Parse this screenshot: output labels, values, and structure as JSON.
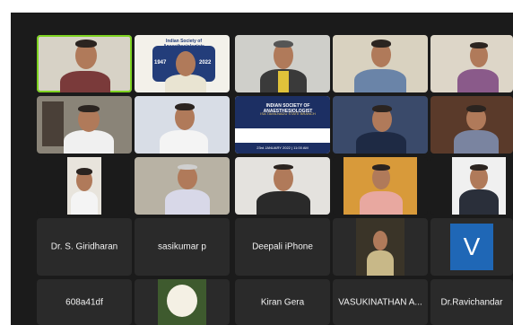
{
  "meeting": {
    "banner": {
      "title": "INDIAN SOCIETY OF ANAESTHESIOLOGIST",
      "subtitle": "ISA TAMILNADU STATE BRANCH",
      "date": "23rd JANUARY 2022 | 11:00 AM"
    },
    "logo": {
      "text": "Indian Society of Anaesthesiologists",
      "year_start": "1947",
      "year_end": "2022"
    },
    "participants_named": [
      {
        "id": "giridharan",
        "name": "Dr. S. Giridharan"
      },
      {
        "id": "sasikumar",
        "name": "sasikumar p"
      },
      {
        "id": "deepali",
        "name": "Deepali iPhone"
      },
      {
        "id": "p608a41df",
        "name": "608a41df"
      },
      {
        "id": "kiran",
        "name": "Kiran Gera"
      },
      {
        "id": "vasukinathan",
        "name": "VASUKINATHAN A..."
      },
      {
        "id": "ravichandar",
        "name": "Dr.Ravichandar"
      }
    ],
    "avatar_letter": "V"
  },
  "colors": {
    "background": "#1b1b1b",
    "tile": "#2a2a2a",
    "active_speaker": "#7ed321",
    "avatar": "#1f67b6"
  }
}
